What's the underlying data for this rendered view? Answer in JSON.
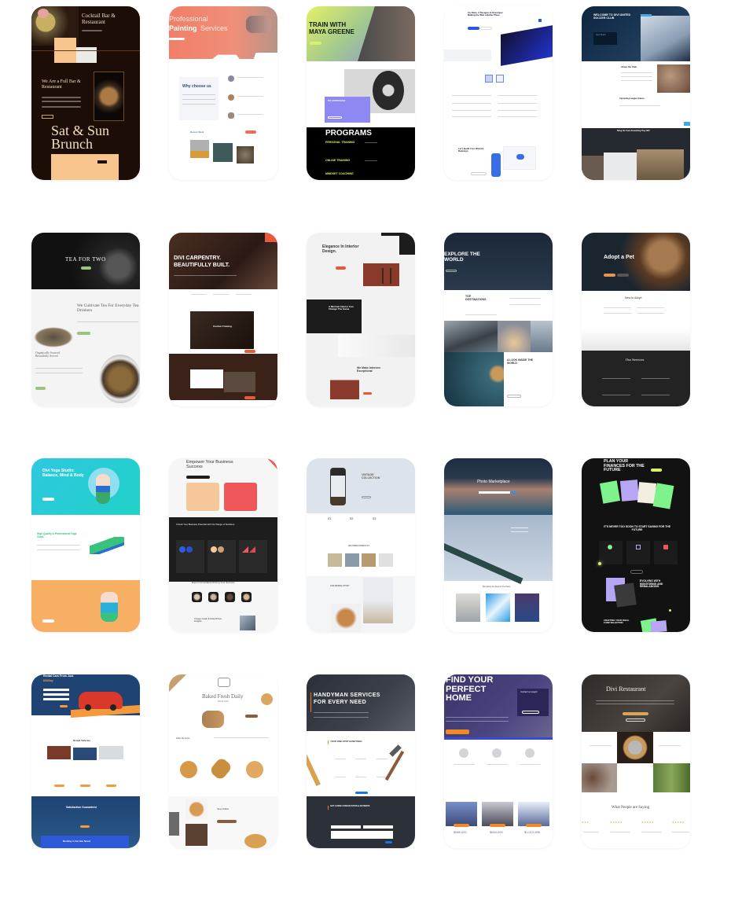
{
  "gallery": {
    "tiles": [
      {
        "name": "cocktail-bar",
        "title": "Cocktail Bar & Restaurant",
        "subtitle": "We Are a Full Bar & Restaurant",
        "hero": "Sat & Sun Brunch",
        "colors": {
          "bg": "#1c0d07",
          "accent": "#f9c58e",
          "text": "#f1dcc0"
        }
      },
      {
        "name": "painting-services",
        "title_light": "Professional",
        "title_bold": "Painting",
        "title_rest": "Services",
        "section": "Why choose us",
        "section2": "Recent Work",
        "colors": {
          "hero": "#f17e68",
          "accent": "#ee6b5a"
        }
      },
      {
        "name": "fitness-trainer",
        "title": "TRAIN WITH MAYA GREENE",
        "card_title": "MY APPROACH",
        "section": "PROGRAMS",
        "programs": [
          "PERSONAL TRAINING",
          "ONLINE TRAINING",
          "MINDSET COACHING"
        ],
        "colors": {
          "accent": "#d6f26a",
          "purple": "#8d88f2",
          "dark": "#000000"
        }
      },
      {
        "name": "designer-developer",
        "title": "I'm Diam, A Designer & Developer Making the Web a Better Place",
        "section": "Let's Build Your Website Redesign",
        "colors": {
          "accent": "#2f55e4"
        }
      },
      {
        "name": "soccer-club",
        "title": "WELCOME TO DIVI UNITED SOCCER CLUB",
        "subtitle": "Next Match",
        "section": "About the Club",
        "section2": "Upcoming League Games",
        "section3": "Bring the Team Something They Will",
        "colors": {
          "hero": "#1b3653",
          "accent": "#3fa9e8"
        }
      },
      {
        "name": "tea-shop",
        "title": "TEA FOR TWO",
        "section": "We Cultivate Tea For Everyday Tea Drinkers",
        "section2": "Organically Sourced Beautifully Served",
        "colors": {
          "hero": "#1a1a1a",
          "accent": "#9bc281"
        }
      },
      {
        "name": "carpentry",
        "title": "DIVI CARPENTRY. BEAUTIFULLY BUILT.",
        "section": "Custom Framing",
        "colors": {
          "hero": "#3a2219",
          "accent": "#e85a3a"
        }
      },
      {
        "name": "interior-design",
        "title": "Elegance In Interior Design.",
        "section": "A Minimal Interior Can Change The Game",
        "section2": "We Make Interiors Exceptional",
        "colors": {
          "accent": "#e8573a",
          "dark": "#1c1c1c"
        }
      },
      {
        "name": "travel",
        "title": "EXPLORE THE WORLD",
        "section": "TOP DESTINATIONS",
        "section2": "A LOOK INSIDE THE WORLD",
        "colors": {
          "hero": "#1e2a38"
        }
      },
      {
        "name": "pet-adoption",
        "title": "Adopt a Pet",
        "section": "New to Adopt",
        "section2": "Our Services",
        "colors": {
          "hero": "#1a2530",
          "accent": "#e29652",
          "dark": "#232323"
        }
      },
      {
        "name": "yoga-studio",
        "title": "Divi Yoga Studio: Balance, Mind & Body",
        "section": "High Quality & Professional Yoga Class",
        "colors": {
          "hero": "#2ec8e0",
          "accent": "#38c27c",
          "orange": "#f7b063"
        }
      },
      {
        "name": "business-consulting",
        "title": "Empower Your Business Success",
        "section": "Unlock Your Business Potential with Our Range of Solutions",
        "section2": "Expert Consultants Driving Your Success",
        "section3": "Unique Goals & Data Driven Insights",
        "colors": {
          "dark": "#1d1d1d",
          "peach": "#f6c79a",
          "red": "#f0575a"
        }
      },
      {
        "name": "vintage-shop",
        "title": "VINTAGE COLLECTION",
        "features": [
          "01",
          "02",
          "03"
        ],
        "section": "FEATURED PRODUCTS",
        "section2": "OUR MINIMAL STORY",
        "colors": {
          "hero": "#dde3ea"
        }
      },
      {
        "name": "photo-marketplace",
        "title": "Photo Marketplace",
        "section": "Everything You Need in One Place",
        "colors": {
          "hero": "#2a3a4e",
          "sky": "#aebfd3",
          "accent": "#3b8fd9"
        }
      },
      {
        "name": "finance-planning",
        "title": "PLAN YOUR FINANCES FOR THE FUTURE",
        "section": "IT'S NEVER TOO SOON TO START SAVING FOR THE FUTURE",
        "section2": "EVOLVING WITH MONITORING AND REBALANCING",
        "section3": "CRAFTING YOUR IDEAL FUND SELECTION",
        "colors": {
          "dark": "#121212",
          "accent": "#7ef28b",
          "purple": "#b6a6f3",
          "lime": "#d6f26a"
        }
      },
      {
        "name": "car-rental",
        "title": "Rental Cars From Just",
        "price": "$99/Day",
        "section": "Rental Vehicles",
        "section2": "Satisfaction Guaranteed",
        "section3": "Renting A Car Has Never",
        "colors": {
          "hero": "#1f4372",
          "accent": "#f49a3a",
          "blue": "#2e59d9"
        }
      },
      {
        "name": "bakery",
        "title": "Baked Fresh Daily",
        "subtitle": "SINCE 1968",
        "section": "What We Serve",
        "section2": "Shop Online",
        "colors": {
          "accent": "#8c5a3c"
        }
      },
      {
        "name": "handyman",
        "title": "HANDYMAN SERVICES FOR EVERY NEED",
        "section": "YOUR ONE-STOP HANDYMAN",
        "section2": "GET A FREE CONSULTATION & ESTIMATE",
        "colors": {
          "hero": "#2c3038",
          "accent": "#ef7a2d",
          "blue": "#1b74e4"
        }
      },
      {
        "name": "real-estate",
        "title": "FIND YOUR PERFECT HOME",
        "card": "Contact an Agent",
        "prices": [
          "$989,000",
          "$654,000",
          "$1,012,895"
        ],
        "colors": {
          "hero": "#3a3468",
          "accent": "#f08a24",
          "price": "#6a6a8a"
        }
      },
      {
        "name": "divi-restaurant",
        "title": "Divi Restaurant",
        "section": "What People are Saying",
        "colors": {
          "hero": "#2f2b28",
          "accent": "#d6a55a"
        }
      }
    ]
  }
}
